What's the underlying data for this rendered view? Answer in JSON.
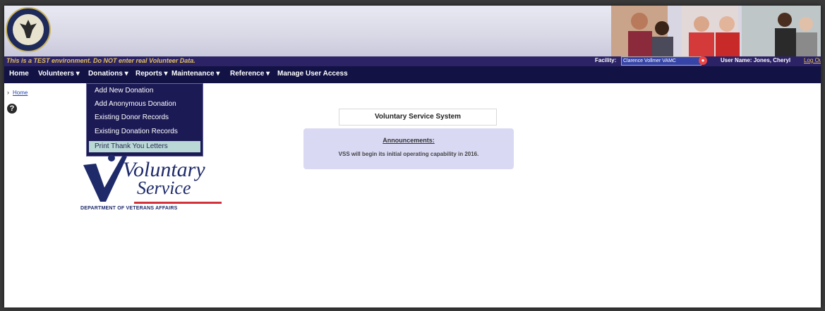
{
  "banner": {
    "warning": "This is a TEST environment. Do NOT enter real Volunteer Data.",
    "facility_label": "Facility:",
    "facility_value": "Clarence Vollmer VAMC",
    "username": "User Name: Jones, Cheryl",
    "logout": "Log Out",
    "seal_icon": "va-seal-icon"
  },
  "nav": {
    "items": [
      {
        "label": "Home"
      },
      {
        "label": "Volunteers ▾"
      },
      {
        "label": "Donations ▾"
      },
      {
        "label": "Reports ▾"
      },
      {
        "label": "Maintenance ▾"
      },
      {
        "label": "Reference ▾"
      },
      {
        "label": "Manage User Access"
      }
    ]
  },
  "dropdown": {
    "items": [
      {
        "label": "Add New Donation"
      },
      {
        "label": "Add Anonymous Donation"
      },
      {
        "label": "Existing Donor Records"
      },
      {
        "label": "Existing Donation Records"
      },
      {
        "label": "Print Thank You Letters"
      }
    ]
  },
  "breadcrumb": {
    "home": "Home"
  },
  "help": {
    "glyph": "?"
  },
  "logo": {
    "line1": "Voluntary",
    "line2": "Service",
    "dept": "DEPARTMENT OF VETERANS AFFAIRS"
  },
  "main": {
    "title": "Voluntary Service System",
    "announcements_title": "Announcements:",
    "announcement": "VSS will begin its initial operating capability in 2016."
  },
  "colors": {
    "navbar": "#121245",
    "warnbar": "#2c2366",
    "announcement_bg": "#d9d9f4",
    "highlight": "#b9d8d6"
  }
}
